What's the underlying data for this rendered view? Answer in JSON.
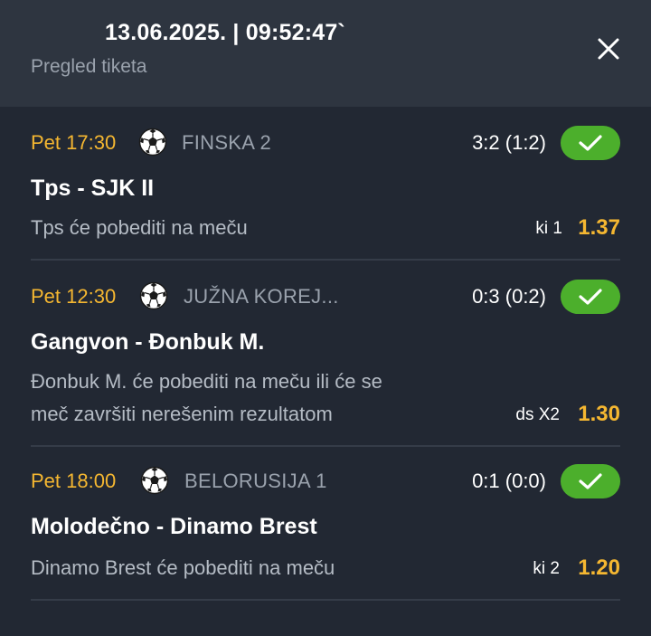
{
  "header": {
    "datetime": "13.06.2025. | 09:52:47`",
    "subtitle": "Pregled tiketa",
    "close_icon": "close-icon"
  },
  "colors": {
    "accent": "#f5b731",
    "success": "#4caf2c",
    "background": "#222833",
    "header_background": "#2e3540"
  },
  "matches": [
    {
      "time": "Pet 17:30",
      "sport_icon": "soccer-ball-icon",
      "league": "FINSKA 2",
      "score": "3:2 (1:2)",
      "status_icon": "check-icon",
      "teams": "Tps - SJK II",
      "pick_line1": "Tps će pobediti na meču",
      "pick_line2": "",
      "bet_code": "ki 1",
      "odd": "1.37"
    },
    {
      "time": "Pet 12:30",
      "sport_icon": "soccer-ball-icon",
      "league": "JUŽNA KOREJ...",
      "score": "0:3 (0:2)",
      "status_icon": "check-icon",
      "teams": "Gangvon - Đonbuk M.",
      "pick_line1": "Đonbuk M. će pobediti na meču ili će se",
      "pick_line2": "meč završiti nerešenim rezultatom",
      "bet_code": "ds X2",
      "odd": "1.30"
    },
    {
      "time": "Pet 18:00",
      "sport_icon": "soccer-ball-icon",
      "league": "BELORUSIJA 1",
      "score": "0:1 (0:0)",
      "status_icon": "check-icon",
      "teams": "Molodečno - Dinamo Brest",
      "pick_line1": "Dinamo Brest će pobediti na meču",
      "pick_line2": "",
      "bet_code": "ki 2",
      "odd": "1.20"
    }
  ]
}
